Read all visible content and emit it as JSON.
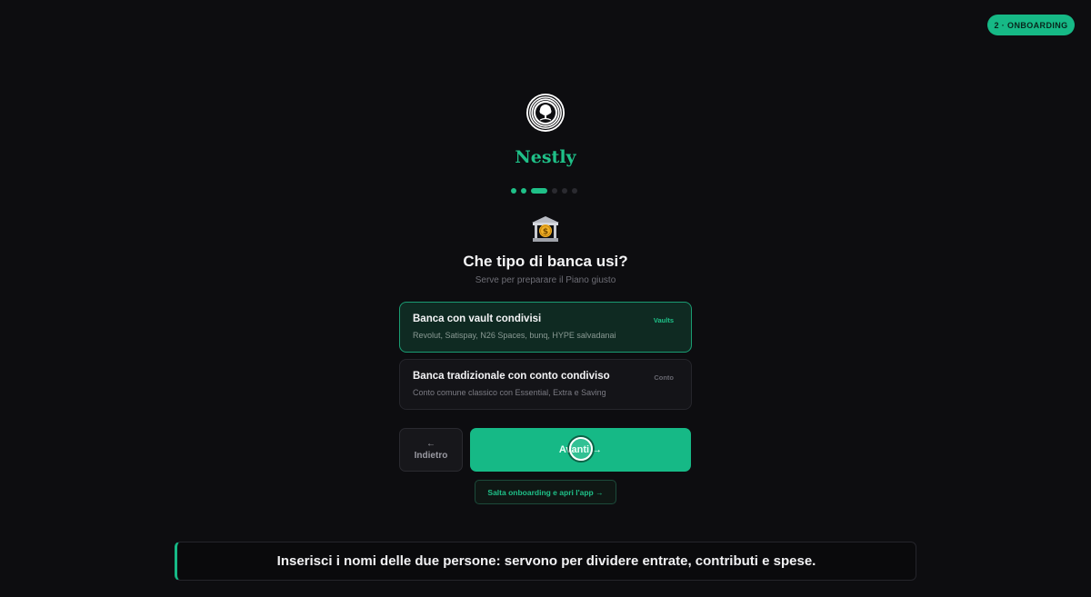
{
  "badge": {
    "label": "2 · ONBOARDING"
  },
  "brand": {
    "name": "Nestly",
    "accent": "#1fc088"
  },
  "progress": {
    "total": 6,
    "current": 3
  },
  "question": {
    "icon": "bank-icon",
    "title": "Che tipo di banca usi?",
    "subtitle": "Serve per preparare il Piano giusto"
  },
  "options": [
    {
      "title": "Banca con vault condivisi",
      "description": "Revolut, Satispay, N26 Spaces, bunq, HYPE salvadanai",
      "tag": "Vaults",
      "selected": true
    },
    {
      "title": "Banca tradizionale con conto condiviso",
      "description": "Conto comune classico con Essential, Extra e Saving",
      "tag": "Conto",
      "selected": false
    }
  ],
  "nav": {
    "back_arrow": "←",
    "back_label": "Indietro",
    "next_label": "Avanti →",
    "skip_label": "Salta onboarding e apri l'app →"
  },
  "caption": {
    "text": "Inserisci i nomi delle due persone: servono per dividere entrate, contributi e spese."
  }
}
